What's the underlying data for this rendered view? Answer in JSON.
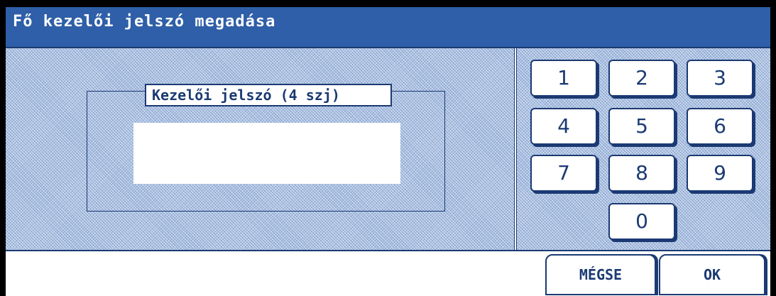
{
  "window": {
    "title": "Fő kezelői jelszó megadása"
  },
  "password_group": {
    "label": "Kezelői jelszó (4 szj)",
    "value": ""
  },
  "keypad": {
    "keys": [
      "1",
      "2",
      "3",
      "4",
      "5",
      "6",
      "7",
      "8",
      "9",
      "0"
    ]
  },
  "actions": {
    "cancel_label": "MÉGSE",
    "ok_label": "OK"
  },
  "colors": {
    "title_bar": "#2e5fa8",
    "accent": "#1b3a73",
    "panel_hatch": "#a9bfe0",
    "background": "#ffffff"
  }
}
